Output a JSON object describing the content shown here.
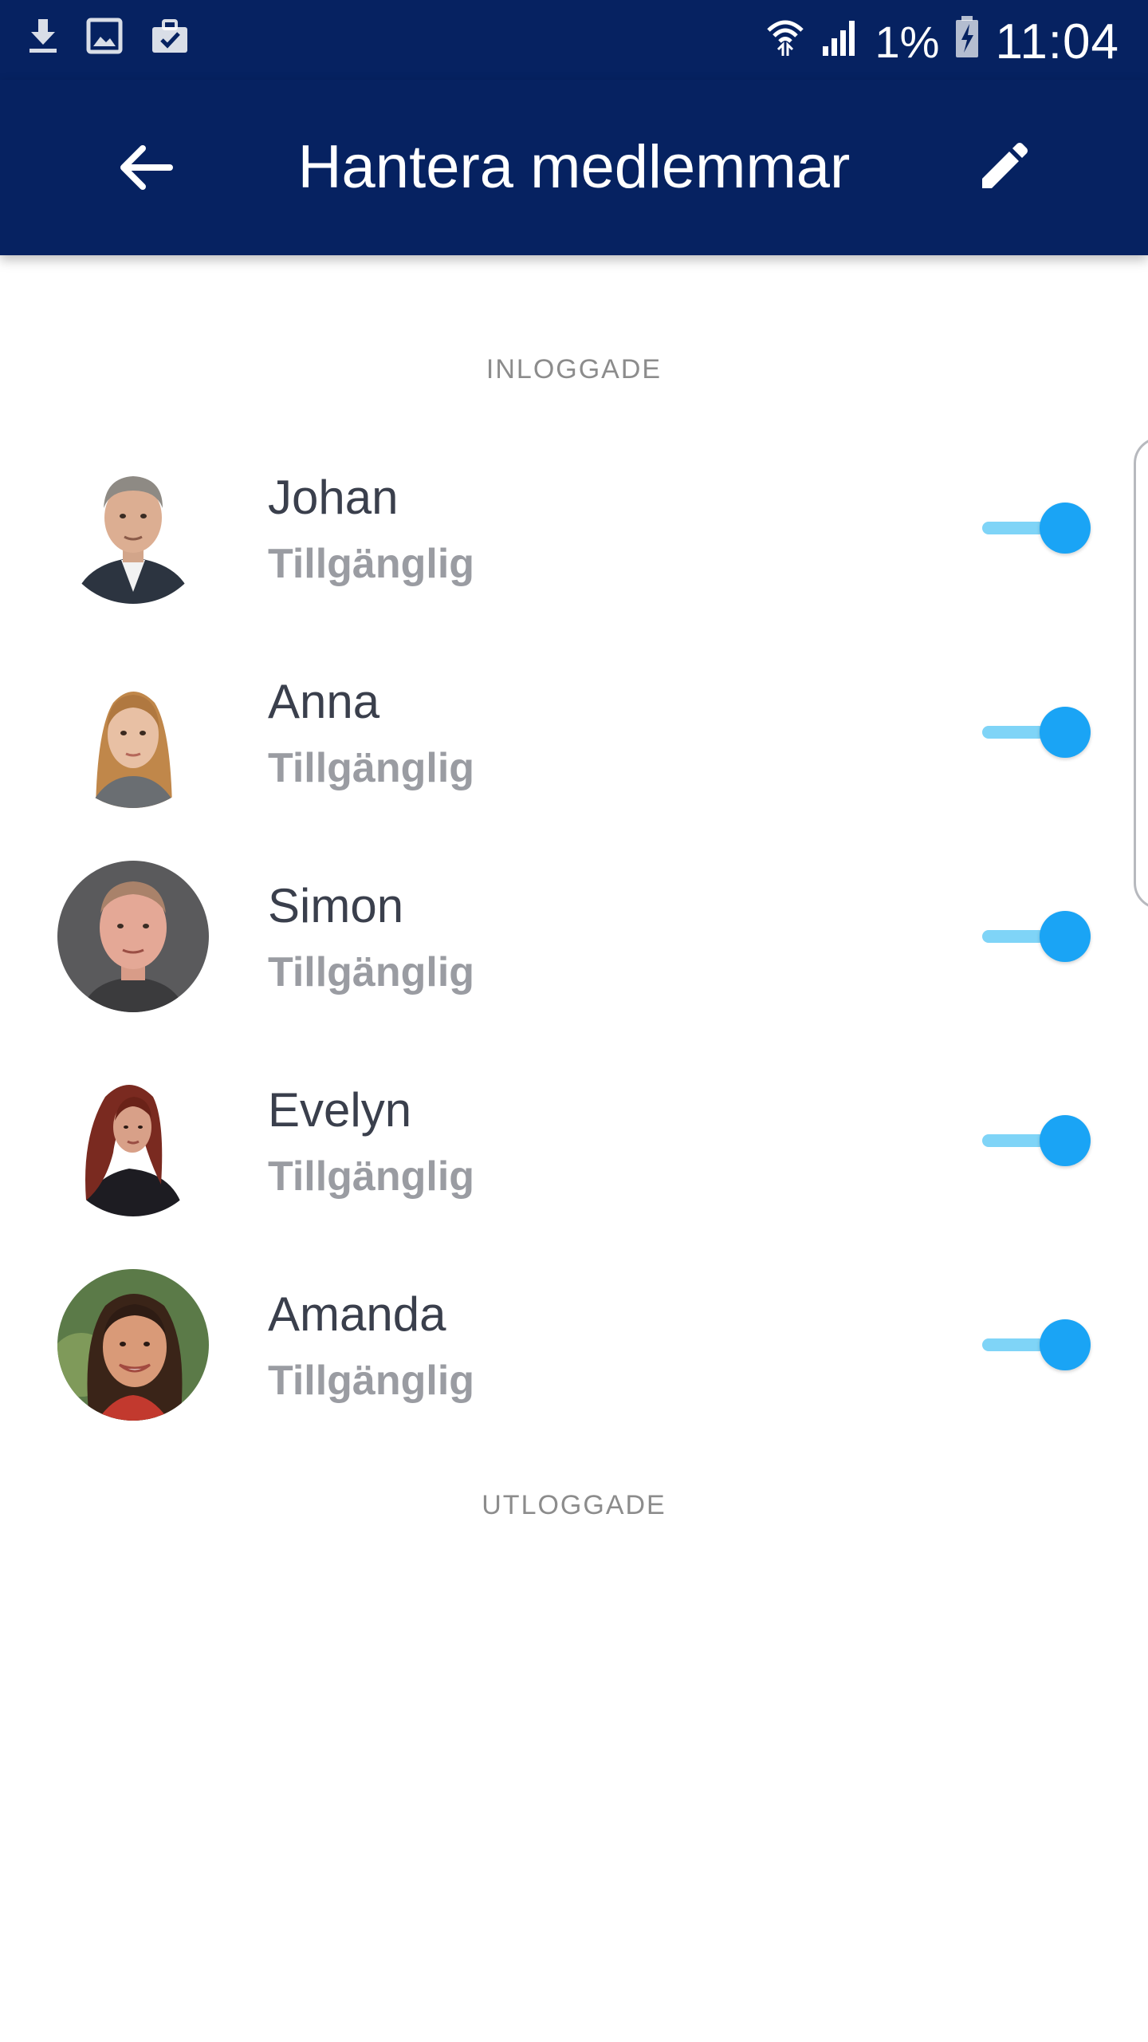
{
  "status_bar": {
    "left_icons": [
      "download-icon",
      "image-icon",
      "briefcase-check-icon"
    ],
    "right_icons": [
      "wifi-icon",
      "signal-icon",
      "battery-charging-icon"
    ],
    "battery_percent": "1%",
    "time": "11:04"
  },
  "app_bar": {
    "title": "Hantera medlemmar",
    "back_icon": "arrow-left-icon",
    "edit_icon": "pencil-icon",
    "background_color": "#062261"
  },
  "sections": {
    "logged_in": "INLOGGADE",
    "logged_out": "UTLOGGADE"
  },
  "members": [
    {
      "name": "Johan",
      "status": "Tillgänglig",
      "enabled": true
    },
    {
      "name": "Anna",
      "status": "Tillgänglig",
      "enabled": true
    },
    {
      "name": "Simon",
      "status": "Tillgänglig",
      "enabled": true
    },
    {
      "name": "Evelyn",
      "status": "Tillgänglig",
      "enabled": true
    },
    {
      "name": "Amanda",
      "status": "Tillgänglig",
      "enabled": true
    }
  ],
  "colors": {
    "toggle_on": "#1aa4f5",
    "toggle_track": "#7fd4f7",
    "name_text": "#3a3f4c",
    "status_text": "#9a9ca2"
  }
}
